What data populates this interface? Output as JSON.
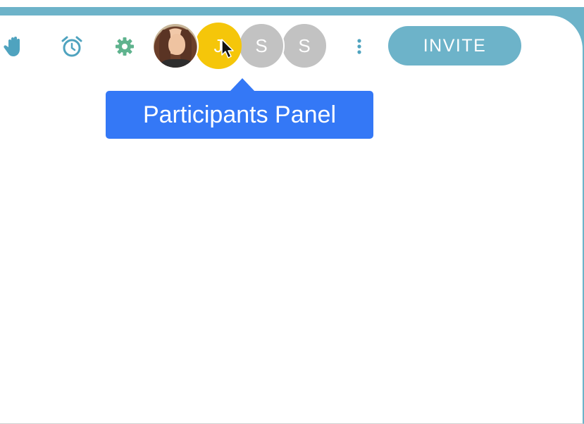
{
  "toolbar": {
    "icons": {
      "raise_hand": "hand-icon",
      "timer": "alarm-clock-icon",
      "settings": "gear-icon",
      "more": "kebab-menu-icon"
    },
    "participants": [
      {
        "type": "photo",
        "initial": ""
      },
      {
        "type": "initial",
        "initial": "J"
      },
      {
        "type": "initial",
        "initial": "S"
      },
      {
        "type": "initial",
        "initial": "S"
      }
    ],
    "invite_label": "INVITE"
  },
  "tooltip": {
    "text": "Participants Panel"
  },
  "colors": {
    "accent": "#6db3c9",
    "tooltip_bg": "#3478f6",
    "settings_icon": "#5fb38e",
    "avatar_yellow": "#f5c60a",
    "avatar_gray": "#c2c2c2"
  }
}
